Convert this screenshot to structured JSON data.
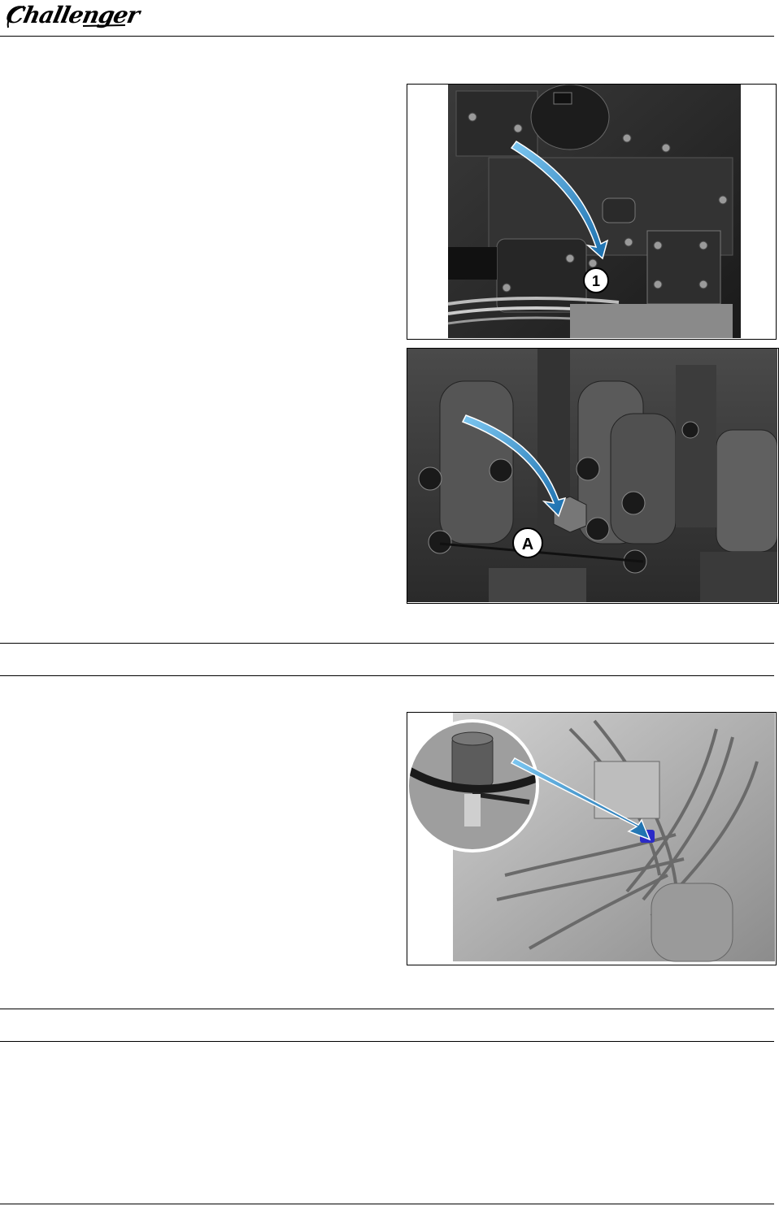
{
  "header": {
    "brand": "Challenger"
  },
  "figures": [
    {
      "name": "figure-oil-filter-housing",
      "callout": "1"
    },
    {
      "name": "figure-pump-mount",
      "callout": "A"
    },
    {
      "name": "figure-sensor-detail",
      "callout": ""
    }
  ],
  "colors": {
    "arrow": "#2f9ad6",
    "arrow_dark": "#1b6fae",
    "highlight": "#2b2bc8",
    "rule": "#000000"
  }
}
